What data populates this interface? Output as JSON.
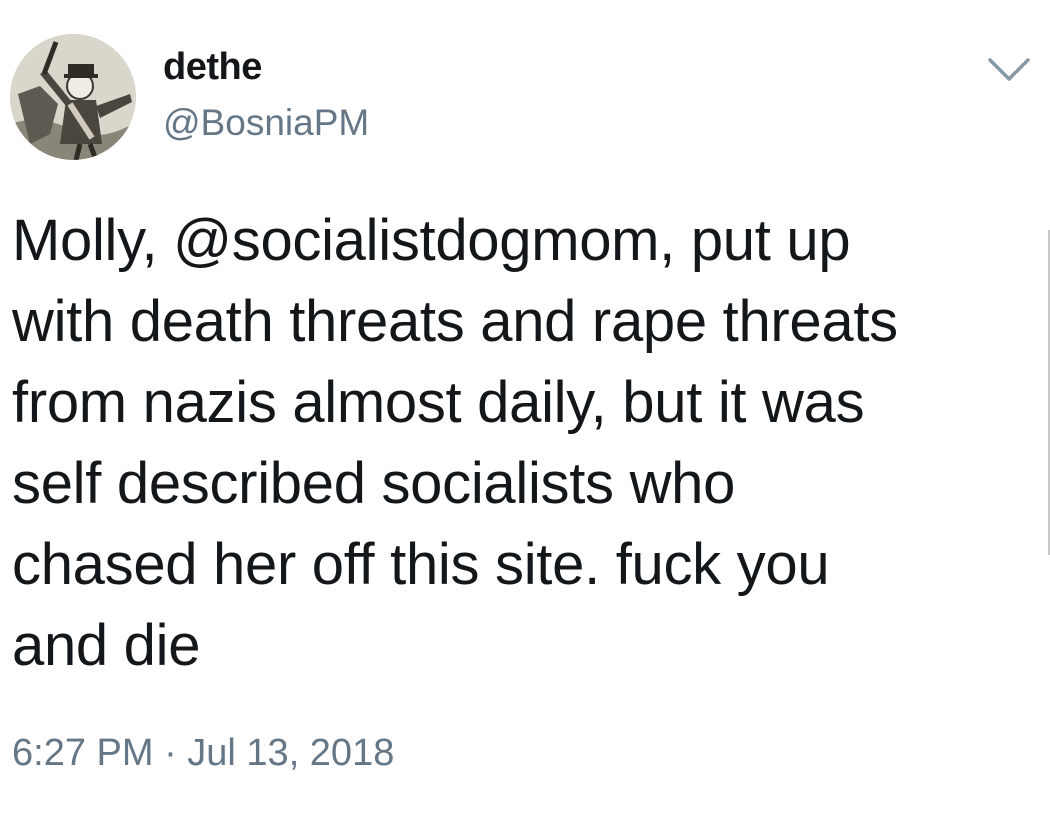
{
  "author": {
    "name": "dethe",
    "handle": "@BosniaPM"
  },
  "avatar_icon": "engraving-figure-avatar",
  "menu_icon": "chevron-down-icon",
  "tweet": {
    "lines": [
      "Molly, @socialistdogmom, put up",
      "with death threats and rape threats",
      "from nazis almost daily, but it was",
      "self described socialists who",
      "chased her off this site. fuck you",
      "and die"
    ],
    "timestamp": "6:27 PM · Jul 13, 2018"
  },
  "colors": {
    "text": "#14171a",
    "secondary": "#657786"
  }
}
